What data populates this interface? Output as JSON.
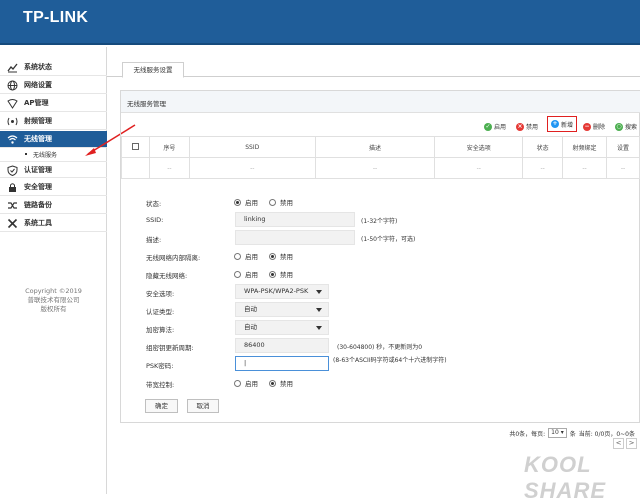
{
  "header": {
    "brand": "TP-LINK"
  },
  "sidebar": {
    "items": [
      {
        "label": "系统状态",
        "icon": "chart-icon"
      },
      {
        "label": "网络设置",
        "icon": "globe-icon"
      },
      {
        "label": "AP管理",
        "icon": "ap-icon"
      },
      {
        "label": "射频管理",
        "icon": "rf-icon"
      },
      {
        "label": "无线管理",
        "icon": "wifi-icon",
        "active": true
      },
      {
        "label": "认证管理",
        "icon": "shield-check-icon"
      },
      {
        "label": "安全管理",
        "icon": "lock-icon"
      },
      {
        "label": "链路备份",
        "icon": "shuffle-icon"
      },
      {
        "label": "系统工具",
        "icon": "tools-icon"
      }
    ],
    "sub_item": "无线服务",
    "copyright": [
      "Copyright ©2019",
      "普联技术有限公司",
      "版权所有"
    ]
  },
  "tab": {
    "label": "无线服务设置"
  },
  "panel": {
    "title": "无线服务管理",
    "toolbar": {
      "enable": "启用",
      "disable": "禁用",
      "add": "新增",
      "delete": "删除",
      "search": "搜索"
    },
    "columns": [
      "序号",
      "SSID",
      "描述",
      "安全选项",
      "状态",
      "射频绑定",
      "设置"
    ],
    "empty_row": [
      "--",
      "--",
      "--",
      "--",
      "--",
      "--",
      "--"
    ]
  },
  "form": {
    "status": {
      "label": "状态:",
      "opt1": "启用",
      "opt2": "禁用",
      "selected": "启用"
    },
    "ssid": {
      "label": "SSID:",
      "value": "linking",
      "hint": "(1-32个字符)"
    },
    "desc": {
      "label": "描述:",
      "value": "",
      "hint": "(1-50个字符，可选)"
    },
    "isolation": {
      "label": "无线网络内部隔离:",
      "opt1": "启用",
      "opt2": "禁用",
      "selected": "禁用"
    },
    "hide": {
      "label": "隐藏无线网络:",
      "opt1": "启用",
      "opt2": "禁用",
      "selected": "禁用"
    },
    "security": {
      "label": "安全选项:",
      "value": "WPA-PSK/WPA2-PSK"
    },
    "auth": {
      "label": "认证类型:",
      "value": "自动"
    },
    "encrypt": {
      "label": "加密算法:",
      "value": "自动"
    },
    "rekey": {
      "label": "组密钥更新周期:",
      "value": "86400",
      "hint": "(30-604800) 秒，不更新则为0"
    },
    "psk": {
      "label": "PSK密码:",
      "value": "|",
      "hint": "(8-63个ASCII码字符或64个十六进制字符)"
    },
    "bandwidth": {
      "label": "带宽控制:",
      "opt1": "启用",
      "opt2": "禁用",
      "selected": "禁用"
    },
    "ok": "确定",
    "cancel": "取消"
  },
  "pager": {
    "total": "共0条，每页:",
    "per_page": "10",
    "unit": "条",
    "page": "当前: 0/0页，0~0条",
    "prev": "<",
    "next": ">"
  },
  "watermark": {
    "text": "KOOL SHARE"
  }
}
